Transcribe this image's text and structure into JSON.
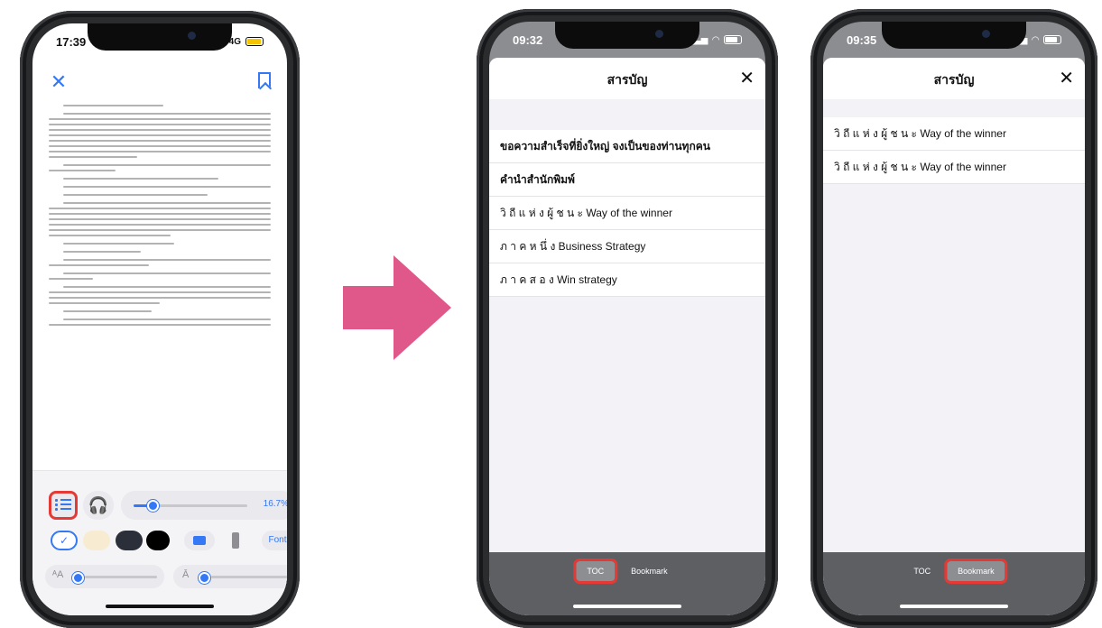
{
  "phone1": {
    "time": "17:39",
    "signal": "4G",
    "progress_label": "16.7%",
    "progress": 0.167,
    "fonts_label": "Fonts",
    "icons": [
      "close-icon",
      "bookmark-icon",
      "toc-list-icon",
      "headphones-icon",
      "check-icon",
      "layout-icon",
      "spacing-icon",
      "font-size-icon",
      "line-spacing-icon"
    ],
    "swatch_colors": [
      "#f7ecd2",
      "#2a2f3a",
      "#000000"
    ],
    "accent": "#3478f6",
    "highlight": "#e53935"
  },
  "phone2": {
    "time": "09:32",
    "title": "สารบัญ",
    "items": [
      "ขอความสำเร็จที่ยิ่งใหญ่ จงเป็นของท่านทุกคน",
      "คำนำสำนักพิมพ์",
      "วิ ถี แ ห่ ง ผู้ ช น ะ Way of the winner",
      "ภ า ค ห นึ่ ง Business Strategy",
      "ภ า ค ส อ ง Win strategy"
    ],
    "tab_toc": "TOC",
    "tab_bookmark": "Bookmark"
  },
  "phone3": {
    "time": "09:35",
    "title": "สารบัญ",
    "items": [
      "วิ ถี แ ห่ ง ผู้ ช น ะ Way of the winner",
      "วิ ถี แ ห่ ง ผู้ ช น ะ Way of the winner"
    ],
    "tab_toc": "TOC",
    "tab_bookmark": "Bookmark"
  },
  "arrow_color": "#e0588a"
}
